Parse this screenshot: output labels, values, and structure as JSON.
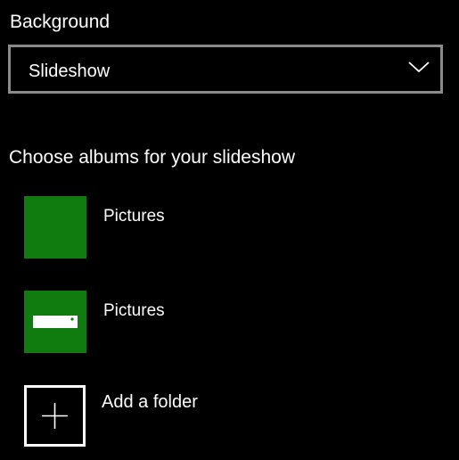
{
  "background": {
    "label": "Background",
    "dropdown": {
      "selected": "Slideshow",
      "icon": "chevron-down-icon"
    }
  },
  "albums": {
    "heading": "Choose albums for your slideshow",
    "tile_color": "#107c10",
    "items": [
      {
        "label": "Pictures",
        "icon": "none"
      },
      {
        "label": "Pictures",
        "icon": "drive-icon"
      }
    ],
    "add": {
      "label": "Add a folder",
      "icon": "plus-icon"
    }
  }
}
